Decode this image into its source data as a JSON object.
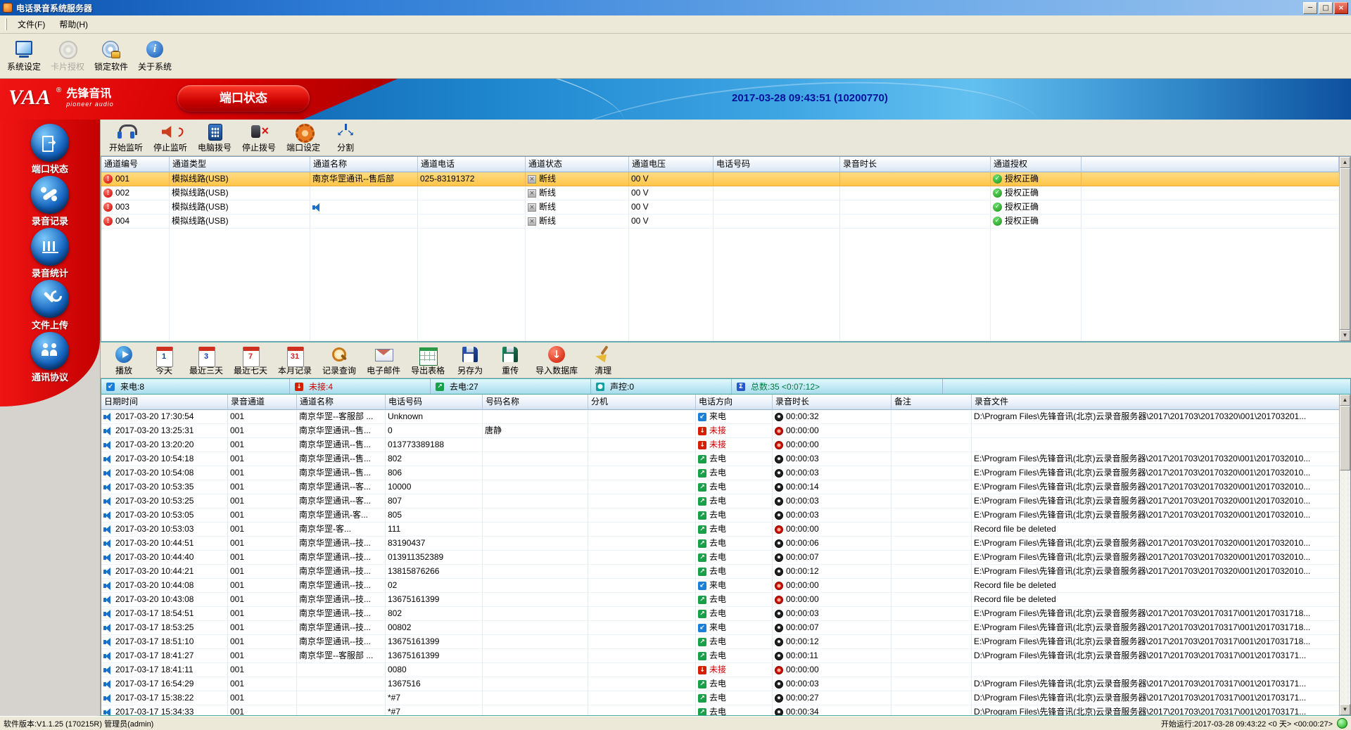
{
  "window": {
    "title": "电话录音系统服务器",
    "menu": [
      {
        "label": "文件(F)",
        "name": "file"
      },
      {
        "label": "帮助(H)",
        "name": "help"
      }
    ],
    "controls": {
      "minimize": "─",
      "maximize": "□",
      "close": "×"
    }
  },
  "toolbar": {
    "items": [
      {
        "label": "系统设定",
        "icon": "i-sysset",
        "name": "system-settings",
        "disabled": false
      },
      {
        "label": "卡片授权",
        "icon": "i-card",
        "name": "card-authorization",
        "disabled": true
      },
      {
        "label": "锁定软件",
        "icon": "i-lockapp",
        "name": "lock-software",
        "disabled": false
      },
      {
        "label": "关于系统",
        "icon": "i-about",
        "name": "about-system",
        "disabled": false
      }
    ]
  },
  "banner": {
    "logo": "VAA",
    "logo_reg": "®",
    "brand": "先锋音讯",
    "brand_en": "pioneer audio",
    "tab": "端口状态",
    "timestamp": "2017-03-28 09:43:51 (10200770)"
  },
  "sidebar": {
    "items": [
      {
        "label": "端口状态",
        "icon": "g-port",
        "name": "port-status",
        "active": true
      },
      {
        "label": "录音记录",
        "icon": "g-rec",
        "name": "recording-records",
        "active": false
      },
      {
        "label": "录音统计",
        "icon": "g-stats",
        "name": "recording-statistics",
        "active": false
      },
      {
        "label": "文件上传",
        "icon": "g-upload",
        "name": "file-upload",
        "active": false
      },
      {
        "label": "通讯协议",
        "icon": "g-protocol",
        "name": "communication-protocol",
        "active": false
      }
    ]
  },
  "port_toolbar": {
    "items": [
      {
        "label": "开始监听",
        "icon": "i-listen",
        "name": "start-monitor"
      },
      {
        "label": "停止监听",
        "icon": "i-stoplisten",
        "name": "stop-monitor"
      },
      {
        "label": "电脑拨号",
        "icon": "i-dial",
        "name": "pc-dial"
      },
      {
        "label": "停止拨号",
        "icon": "i-stopdial",
        "name": "stop-dial"
      },
      {
        "label": "端口设定",
        "icon": "i-portset",
        "name": "port-settings"
      },
      {
        "label": "分割",
        "icon": "i-split",
        "name": "split"
      }
    ]
  },
  "port_table": {
    "columns": [
      "通道编号",
      "通道类型",
      "通道名称",
      "通道电话",
      "通道状态",
      "通道电压",
      "电话号码",
      "录音时长",
      "通道授权"
    ],
    "rows": [
      {
        "id": "001",
        "type": "模拟线路(USB)",
        "name": "南京华罡通讯--售后部",
        "phone": "025-83191372",
        "status": "断线",
        "voltage": "00 V",
        "number": "",
        "duration": "",
        "auth": "授权正确",
        "selected": true,
        "speaker": false
      },
      {
        "id": "002",
        "type": "模拟线路(USB)",
        "name": "",
        "phone": "",
        "status": "断线",
        "voltage": "00 V",
        "number": "",
        "duration": "",
        "auth": "授权正确",
        "selected": false,
        "speaker": false
      },
      {
        "id": "003",
        "type": "模拟线路(USB)",
        "name": "",
        "phone": "",
        "status": "断线",
        "voltage": "00 V",
        "number": "",
        "duration": "",
        "auth": "授权正确",
        "selected": false,
        "speaker": true
      },
      {
        "id": "004",
        "type": "模拟线路(USB)",
        "name": "",
        "phone": "",
        "status": "断线",
        "voltage": "00 V",
        "number": "",
        "duration": "",
        "auth": "授权正确",
        "selected": false,
        "speaker": false
      }
    ]
  },
  "records_toolbar": {
    "items": [
      {
        "label": "播放",
        "icon": "i-play",
        "name": "play"
      },
      {
        "label": "今天",
        "icon": "i-cal n1",
        "name": "today"
      },
      {
        "label": "最近三天",
        "icon": "i-cal n3",
        "name": "last-3-days"
      },
      {
        "label": "最近七天",
        "icon": "i-cal n7",
        "name": "last-7-days"
      },
      {
        "label": "本月记录",
        "icon": "i-cal n31",
        "name": "this-month"
      },
      {
        "label": "记录查询",
        "icon": "i-search",
        "name": "record-search"
      },
      {
        "label": "电子邮件",
        "icon": "i-mail",
        "name": "email"
      },
      {
        "label": "导出表格",
        "icon": "i-export",
        "name": "export-table"
      },
      {
        "label": "另存为",
        "icon": "i-save",
        "name": "save-as"
      },
      {
        "label": "重传",
        "icon": "i-resend",
        "name": "resend"
      },
      {
        "label": "导入数据库",
        "icon": "i-import",
        "name": "import-database"
      },
      {
        "label": "清理",
        "icon": "i-clean",
        "name": "cleanup"
      }
    ]
  },
  "stats": {
    "items": [
      {
        "label": "来电:8",
        "name": "incoming-count",
        "char": "↙",
        "icon_color": "#1b7fd8",
        "color": "#000000"
      },
      {
        "label": "未接:4",
        "name": "missed-count",
        "char": "↓",
        "icon_color": "#d42000",
        "color": "#d40000"
      },
      {
        "label": "去电:27",
        "name": "outgoing-count",
        "char": "↗",
        "icon_color": "#18a048",
        "color": "#000000"
      },
      {
        "label": "声控:0",
        "name": "voice-activated-count",
        "char": "●",
        "icon_color": "#10a0a0",
        "color": "#000000"
      },
      {
        "label": "总数:35 <0:07:12>",
        "name": "total-count",
        "char": "Σ",
        "icon_color": "#2858c8",
        "color": "#007a3d"
      }
    ]
  },
  "records_table": {
    "columns": [
      "日期时间",
      "录音通道",
      "通道名称",
      "电话号码",
      "号码名称",
      "分机",
      "电话方向",
      "录音时长",
      "备注",
      "录音文件"
    ],
    "rows": [
      {
        "time": "2017-03-20 17:30:54",
        "ch": "001",
        "name": "南京华罡--客服部 ...",
        "phone": "Unknown",
        "pname": "",
        "ext": "",
        "dir": "来电",
        "dirtype": "in",
        "dur": "00:00:32",
        "zero": false,
        "note": "",
        "file": "D:\\Program Files\\先锋音讯(北京)云录音服务器\\2017\\201703\\20170320\\001\\201703201..."
      },
      {
        "time": "2017-03-20 13:25:31",
        "ch": "001",
        "name": "南京华罡通讯--售...",
        "phone": "0",
        "pname": "唐静",
        "ext": "",
        "dir": "未接",
        "dirtype": "miss",
        "dur": "00:00:00",
        "zero": true,
        "note": "",
        "file": ""
      },
      {
        "time": "2017-03-20 13:20:20",
        "ch": "001",
        "name": "南京华罡通讯--售...",
        "phone": "013773389188",
        "pname": "",
        "ext": "",
        "dir": "未接",
        "dirtype": "miss",
        "dur": "00:00:00",
        "zero": true,
        "note": "",
        "file": ""
      },
      {
        "time": "2017-03-20 10:54:18",
        "ch": "001",
        "name": "南京华罡通讯--售...",
        "phone": "802",
        "pname": "",
        "ext": "",
        "dir": "去电",
        "dirtype": "out",
        "dur": "00:00:03",
        "zero": false,
        "note": "",
        "file": "E:\\Program Files\\先锋音讯(北京)云录音服务器\\2017\\201703\\20170320\\001\\2017032010..."
      },
      {
        "time": "2017-03-20 10:54:08",
        "ch": "001",
        "name": "南京华罡通讯--售...",
        "phone": "806",
        "pname": "",
        "ext": "",
        "dir": "去电",
        "dirtype": "out",
        "dur": "00:00:03",
        "zero": false,
        "note": "",
        "file": "E:\\Program Files\\先锋音讯(北京)云录音服务器\\2017\\201703\\20170320\\001\\2017032010..."
      },
      {
        "time": "2017-03-20 10:53:35",
        "ch": "001",
        "name": "南京华罡通讯--客...",
        "phone": "10000",
        "pname": "",
        "ext": "",
        "dir": "去电",
        "dirtype": "out",
        "dur": "00:00:14",
        "zero": false,
        "note": "",
        "file": "E:\\Program Files\\先锋音讯(北京)云录音服务器\\2017\\201703\\20170320\\001\\2017032010..."
      },
      {
        "time": "2017-03-20 10:53:25",
        "ch": "001",
        "name": "南京华罡通讯--客...",
        "phone": "807",
        "pname": "",
        "ext": "",
        "dir": "去电",
        "dirtype": "out",
        "dur": "00:00:03",
        "zero": false,
        "note": "",
        "file": "E:\\Program Files\\先锋音讯(北京)云录音服务器\\2017\\201703\\20170320\\001\\2017032010..."
      },
      {
        "time": "2017-03-20 10:53:05",
        "ch": "001",
        "name": "南京华罡通讯-客...",
        "phone": "805",
        "pname": "",
        "ext": "",
        "dir": "去电",
        "dirtype": "out",
        "dur": "00:00:03",
        "zero": false,
        "note": "",
        "file": "E:\\Program Files\\先锋音讯(北京)云录音服务器\\2017\\201703\\20170320\\001\\2017032010..."
      },
      {
        "time": "2017-03-20 10:53:03",
        "ch": "001",
        "name": "南京华罡-客...",
        "phone": "111",
        "pname": "",
        "ext": "",
        "dir": "去电",
        "dirtype": "out",
        "dur": "00:00:00",
        "zero": true,
        "note": "",
        "file": "Record file be deleted"
      },
      {
        "time": "2017-03-20 10:44:51",
        "ch": "001",
        "name": "南京华罡通讯--技...",
        "phone": "83190437",
        "pname": "",
        "ext": "",
        "dir": "去电",
        "dirtype": "out",
        "dur": "00:00:06",
        "zero": false,
        "note": "",
        "file": "E:\\Program Files\\先锋音讯(北京)云录音服务器\\2017\\201703\\20170320\\001\\2017032010..."
      },
      {
        "time": "2017-03-20 10:44:40",
        "ch": "001",
        "name": "南京华罡通讯--技...",
        "phone": "013911352389",
        "pname": "",
        "ext": "",
        "dir": "去电",
        "dirtype": "out",
        "dur": "00:00:07",
        "zero": false,
        "note": "",
        "file": "E:\\Program Files\\先锋音讯(北京)云录音服务器\\2017\\201703\\20170320\\001\\2017032010..."
      },
      {
        "time": "2017-03-20 10:44:21",
        "ch": "001",
        "name": "南京华罡通讯--技...",
        "phone": "13815876266",
        "pname": "",
        "ext": "",
        "dir": "去电",
        "dirtype": "out",
        "dur": "00:00:12",
        "zero": false,
        "note": "",
        "file": "E:\\Program Files\\先锋音讯(北京)云录音服务器\\2017\\201703\\20170320\\001\\2017032010..."
      },
      {
        "time": "2017-03-20 10:44:08",
        "ch": "001",
        "name": "南京华罡通讯--技...",
        "phone": "02",
        "pname": "",
        "ext": "",
        "dir": "来电",
        "dirtype": "in",
        "dur": "00:00:00",
        "zero": true,
        "note": "",
        "file": "Record file be deleted"
      },
      {
        "time": "2017-03-20 10:43:08",
        "ch": "001",
        "name": "南京华罡通讯--技...",
        "phone": "13675161399",
        "pname": "",
        "ext": "",
        "dir": "去电",
        "dirtype": "out",
        "dur": "00:00:00",
        "zero": true,
        "note": "",
        "file": "Record file be deleted"
      },
      {
        "time": "2017-03-17 18:54:51",
        "ch": "001",
        "name": "南京华罡通讯--技...",
        "phone": "802",
        "pname": "",
        "ext": "",
        "dir": "去电",
        "dirtype": "out",
        "dur": "00:00:03",
        "zero": false,
        "note": "",
        "file": "E:\\Program Files\\先锋音讯(北京)云录音服务器\\2017\\201703\\20170317\\001\\2017031718..."
      },
      {
        "time": "2017-03-17 18:53:25",
        "ch": "001",
        "name": "南京华罡通讯--技...",
        "phone": "00802",
        "pname": "",
        "ext": "",
        "dir": "来电",
        "dirtype": "in",
        "dur": "00:00:07",
        "zero": false,
        "note": "",
        "file": "E:\\Program Files\\先锋音讯(北京)云录音服务器\\2017\\201703\\20170317\\001\\2017031718..."
      },
      {
        "time": "2017-03-17 18:51:10",
        "ch": "001",
        "name": "南京华罡通讯--技...",
        "phone": "13675161399",
        "pname": "",
        "ext": "",
        "dir": "去电",
        "dirtype": "out",
        "dur": "00:00:12",
        "zero": false,
        "note": "",
        "file": "E:\\Program Files\\先锋音讯(北京)云录音服务器\\2017\\201703\\20170317\\001\\2017031718..."
      },
      {
        "time": "2017-03-17 18:41:27",
        "ch": "001",
        "name": "南京华罡--客服部 ...",
        "phone": "13675161399",
        "pname": "",
        "ext": "",
        "dir": "去电",
        "dirtype": "out",
        "dur": "00:00:11",
        "zero": false,
        "note": "",
        "file": "D:\\Program Files\\先锋音讯(北京)云录音服务器\\2017\\201703\\20170317\\001\\201703171..."
      },
      {
        "time": "2017-03-17 18:41:11",
        "ch": "001",
        "name": "",
        "phone": "0080",
        "pname": "",
        "ext": "",
        "dir": "未接",
        "dirtype": "miss",
        "dur": "00:00:00",
        "zero": true,
        "note": "",
        "file": ""
      },
      {
        "time": "2017-03-17 16:54:29",
        "ch": "001",
        "name": "",
        "phone": "1367516",
        "pname": "",
        "ext": "",
        "dir": "去电",
        "dirtype": "out",
        "dur": "00:00:03",
        "zero": false,
        "note": "",
        "file": "D:\\Program Files\\先锋音讯(北京)云录音服务器\\2017\\201703\\20170317\\001\\201703171..."
      },
      {
        "time": "2017-03-17 15:38:22",
        "ch": "001",
        "name": "",
        "phone": "*#7",
        "pname": "",
        "ext": "",
        "dir": "去电",
        "dirtype": "out",
        "dur": "00:00:27",
        "zero": false,
        "note": "",
        "file": "D:\\Program Files\\先锋音讯(北京)云录音服务器\\2017\\201703\\20170317\\001\\201703171..."
      },
      {
        "time": "2017-03-17 15:34:33",
        "ch": "001",
        "name": "",
        "phone": "*#7",
        "pname": "",
        "ext": "",
        "dir": "去电",
        "dirtype": "out",
        "dur": "00:00:34",
        "zero": false,
        "note": "",
        "file": "D:\\Program Files\\先锋音讯(北京)云录音服务器\\2017\\201703\\20170317\\001\\201703171..."
      }
    ]
  },
  "statusbar": {
    "left": "软件版本:V1.1.25 (170215R) 管理员(admin)",
    "right": "开始运行:2017-03-28 09:43:22 <0 天> <00:00:27>"
  },
  "colors": {
    "sidebar_red": "#d40000",
    "selected_row": "#ffc84a",
    "banner_blue": "#1e7cc8",
    "teal_border": "#2ca8a0",
    "incoming": "#1b7fd8",
    "missed": "#d42000",
    "outgoing": "#18a048"
  }
}
